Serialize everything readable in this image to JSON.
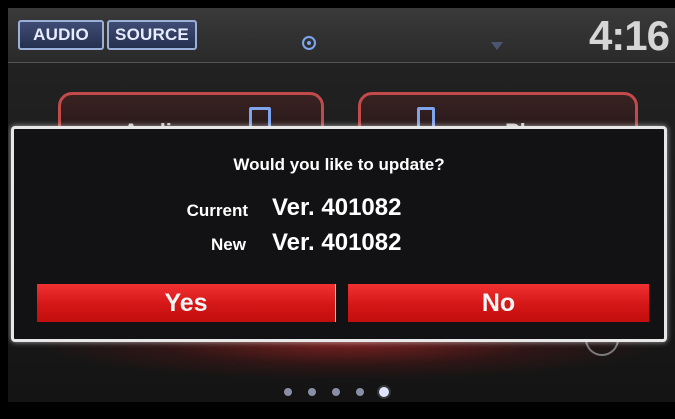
{
  "header": {
    "audio_label": "AUDIO",
    "source_label": "SOURCE",
    "clock": "4:16",
    "nav_icon": "navigation-icon",
    "wifi_icon": "wifi-icon"
  },
  "home_tiles": [
    {
      "label": "Audio",
      "icon": "screen-icon"
    },
    {
      "label": "Phone",
      "icon": "phone-icon"
    }
  ],
  "dialog": {
    "question": "Would you like to update?",
    "current_label": "Current",
    "current_version": "Ver. 401082",
    "new_label": "New",
    "new_version": "Ver. 401082",
    "yes_label": "Yes",
    "no_label": "No"
  },
  "pager": {
    "page_count": 5,
    "active_page": 5
  },
  "colors": {
    "accent_red": "#e41e1e",
    "button_blue": "#2f3a5c",
    "dialog_bg": "#121214"
  }
}
